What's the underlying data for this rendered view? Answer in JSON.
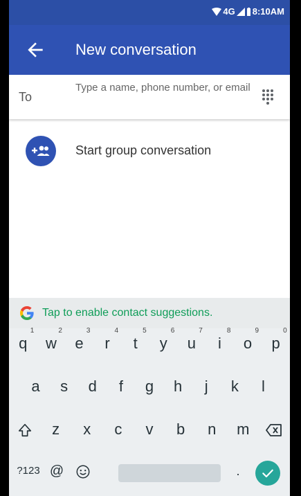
{
  "status": {
    "network": "4G",
    "time": "8:10AM"
  },
  "appbar": {
    "title": "New conversation"
  },
  "to_row": {
    "label": "To",
    "placeholder": "Type a name, phone number, or email"
  },
  "group": {
    "label": "Start group conversation"
  },
  "suggestion": {
    "text": "Tap to enable contact suggestions."
  },
  "keyboard": {
    "row1": [
      {
        "key": "q",
        "sup": "1"
      },
      {
        "key": "w",
        "sup": "2"
      },
      {
        "key": "e",
        "sup": "3"
      },
      {
        "key": "r",
        "sup": "4"
      },
      {
        "key": "t",
        "sup": "5"
      },
      {
        "key": "y",
        "sup": "6"
      },
      {
        "key": "u",
        "sup": "7"
      },
      {
        "key": "i",
        "sup": "8"
      },
      {
        "key": "o",
        "sup": "9"
      },
      {
        "key": "p",
        "sup": "0"
      }
    ],
    "row2": [
      "a",
      "s",
      "d",
      "f",
      "g",
      "h",
      "j",
      "k",
      "l"
    ],
    "row3": [
      "z",
      "x",
      "c",
      "v",
      "b",
      "n",
      "m"
    ],
    "symbols_label": "?123",
    "at_label": "@",
    "period_label": "."
  },
  "colors": {
    "primary": "#2f52b3",
    "status_bar": "#2c4fa6",
    "accent_green": "#0f9d58",
    "enter_key": "#26a69a"
  }
}
